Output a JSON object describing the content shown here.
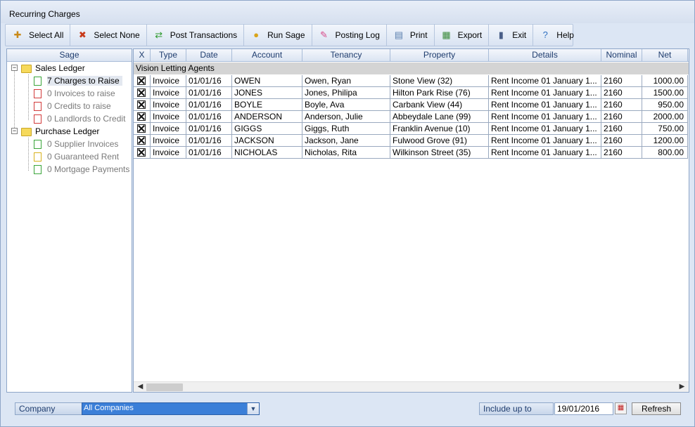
{
  "window": {
    "title": "Recurring Charges"
  },
  "toolbar": [
    {
      "label": "Select All",
      "icon": "select-all-icon",
      "glyph": "✚",
      "color": "#c98a1a"
    },
    {
      "label": "Select None",
      "icon": "select-none-icon",
      "glyph": "✖",
      "color": "#c83a1a"
    },
    {
      "label": "Post Transactions",
      "icon": "post-transactions-icon",
      "glyph": "⇄",
      "color": "#2e9a2e"
    },
    {
      "label": "Run Sage",
      "icon": "run-sage-icon",
      "glyph": "●",
      "color": "#d9a41a"
    },
    {
      "label": "Posting Log",
      "icon": "posting-log-icon",
      "glyph": "✎",
      "color": "#d84a8a"
    },
    {
      "label": "Print",
      "icon": "print-icon",
      "glyph": "▤",
      "color": "#5b7fae"
    },
    {
      "label": "Export",
      "icon": "export-icon",
      "glyph": "▦",
      "color": "#3a8a3a"
    },
    {
      "label": "Exit",
      "icon": "exit-icon",
      "glyph": "▮",
      "color": "#4a5f88"
    },
    {
      "label": "Help",
      "icon": "help-icon",
      "glyph": "?",
      "color": "#2f6fc0"
    }
  ],
  "tree": {
    "header": "Sage",
    "sales": {
      "label": "Sales Ledger",
      "items": [
        {
          "label": "7 Charges to Raise",
          "doc": "green"
        },
        {
          "label": "0 Invoices to raise",
          "doc": "red"
        },
        {
          "label": "0 Credits to raise",
          "doc": "red"
        },
        {
          "label": "0 Landlords to Credit",
          "doc": "red"
        }
      ]
    },
    "purchase": {
      "label": "Purchase Ledger",
      "items": [
        {
          "label": "0 Supplier Invoices",
          "doc": "green"
        },
        {
          "label": "0 Guaranteed Rent",
          "doc": "yellow"
        },
        {
          "label": "0 Mortgage Payments",
          "doc": "green"
        }
      ]
    }
  },
  "grid": {
    "columns": [
      "X",
      "Type",
      "Date",
      "Account",
      "Tenancy",
      "Property",
      "Details",
      "Nominal",
      "Net"
    ],
    "group_label": "Vision Letting Agents",
    "rows": [
      [
        "Invoice",
        "01/01/16",
        "OWEN",
        "Owen, Ryan",
        "Stone View (32)",
        "Rent Income 01 January 1...",
        "2160",
        "1000.00"
      ],
      [
        "Invoice",
        "01/01/16",
        "JONES",
        "Jones, Philipa",
        "Hilton Park Rise (76)",
        "Rent Income 01 January 1...",
        "2160",
        "1500.00"
      ],
      [
        "Invoice",
        "01/01/16",
        "BOYLE",
        "Boyle, Ava",
        "Carbank View (44)",
        "Rent Income 01 January 1...",
        "2160",
        "950.00"
      ],
      [
        "Invoice",
        "01/01/16",
        "ANDERSON",
        "Anderson, Julie",
        "Abbeydale Lane (99)",
        "Rent Income 01 January 1...",
        "2160",
        "2000.00"
      ],
      [
        "Invoice",
        "01/01/16",
        "GIGGS",
        "Giggs, Ruth",
        "Franklin Avenue (10)",
        "Rent Income 01 January 1...",
        "2160",
        "750.00"
      ],
      [
        "Invoice",
        "01/01/16",
        "JACKSON",
        "Jackson, Jane",
        "Fulwood Grove (91)",
        "Rent Income 01 January 1...",
        "2160",
        "1200.00"
      ],
      [
        "Invoice",
        "01/01/16",
        "NICHOLAS",
        "Nicholas, Rita",
        "Wilkinson Street (35)",
        "Rent Income 01 January 1...",
        "2160",
        "800.00"
      ]
    ]
  },
  "footer": {
    "company_label": "Company",
    "company_value": "All Companies",
    "include_label": "Include up to",
    "date_value": "19/01/2016",
    "refresh_label": "Refresh"
  }
}
